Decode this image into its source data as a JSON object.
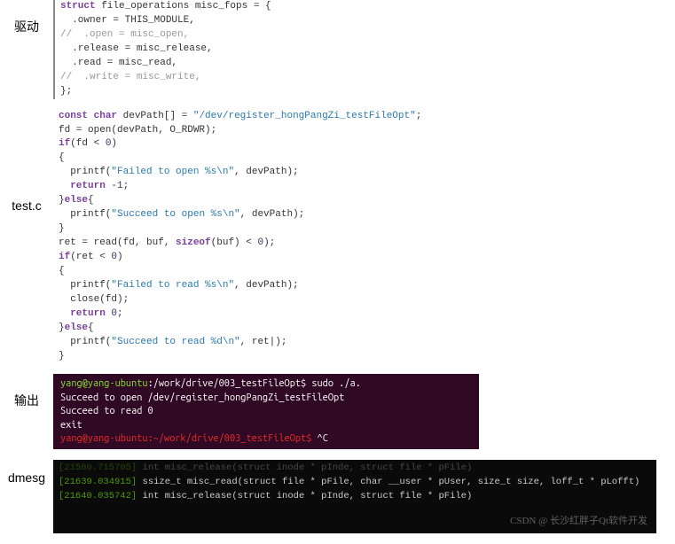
{
  "labels": {
    "driver": "驱动",
    "testc": "test.c",
    "output": "输出",
    "dmesg": "dmesg"
  },
  "driver_code": {
    "l1a": "struct",
    "l1b": " file_operations misc_fops = {",
    "l2": "  .owner = THIS_MODULE,",
    "l3": "//  .open = misc_open,",
    "l4": "  .release = misc_release,",
    "l5": "  .read = misc_read,",
    "l6": "//  .write = misc_write,",
    "l7": "};"
  },
  "test_code": {
    "l1a": "const",
    "l1b": " char",
    "l1c": " devPath[] = ",
    "l1d": "\"/dev/register_hongPangZi_testFileOpt\"",
    "l1e": ";",
    "l2": "fd = open(devPath, O_RDWR);",
    "l3a": "if",
    "l3b": "(fd < ",
    "l3c": "0",
    "l3d": ")",
    "l4": "{",
    "l5a": "  printf(",
    "l5b": "\"Failed to open %s\\n\"",
    "l5c": ", devPath);",
    "l6a": "  return",
    "l6b": " -",
    "l6c": "1",
    "l6d": ";",
    "l7a": "}",
    "l7b": "else",
    "l7c": "{",
    "l8a": "  printf(",
    "l8b": "\"Succeed to open %s\\n\"",
    "l8c": ", devPath);",
    "l9": "}",
    "l10a": "ret = read(fd, buf, ",
    "l10b": "sizeof",
    "l10c": "(buf) < ",
    "l10d": "0",
    "l10e": ");",
    "l11a": "if",
    "l11b": "(ret < ",
    "l11c": "0",
    "l11d": ")",
    "l12": "{",
    "l13a": "  printf(",
    "l13b": "\"Failed to read %s\\n\"",
    "l13c": ", devPath);",
    "l14": "  close(fd);",
    "l15a": "  return",
    "l15b": " 0",
    "l15c": ";",
    "l16a": "}",
    "l16b": "else",
    "l16c": "{",
    "l17a": "  printf(",
    "l17b": "\"Succeed to read %d\\n\"",
    "l17c": ", ret|);",
    "l18": "}"
  },
  "terminal": {
    "l1a": "yang@yang-ubuntu",
    "l1b": ":/work/drive/003_testFileOpt$",
    "l1c": " sudo ./a.",
    "l2": "Succeed to open /dev/register_hongPangZi_testFileOpt",
    "l3": "Succeed to read 0",
    "l4": "exit",
    "l5a": "yang@yang-ubuntu",
    "l5b": ":~/work/drive/003_testFileOpt$",
    "l5c": " ^C"
  },
  "dmesg": {
    "l0a": "[21580.715705]",
    "l0b": " int misc_release(struct inode * pInde, struct file * pFile)",
    "l1a": "[21639.034915]",
    "l1b": " ssize_t misc_read(struct file * pFile, char __user * pUser, size_t size, loff_t * pLofft)",
    "l2a": "[21640.035742]",
    "l2b": " int misc_release(struct inode * pInde, struct file * pFile)"
  },
  "watermark": "CSDN @ 长沙红胖子Qt软件开发"
}
